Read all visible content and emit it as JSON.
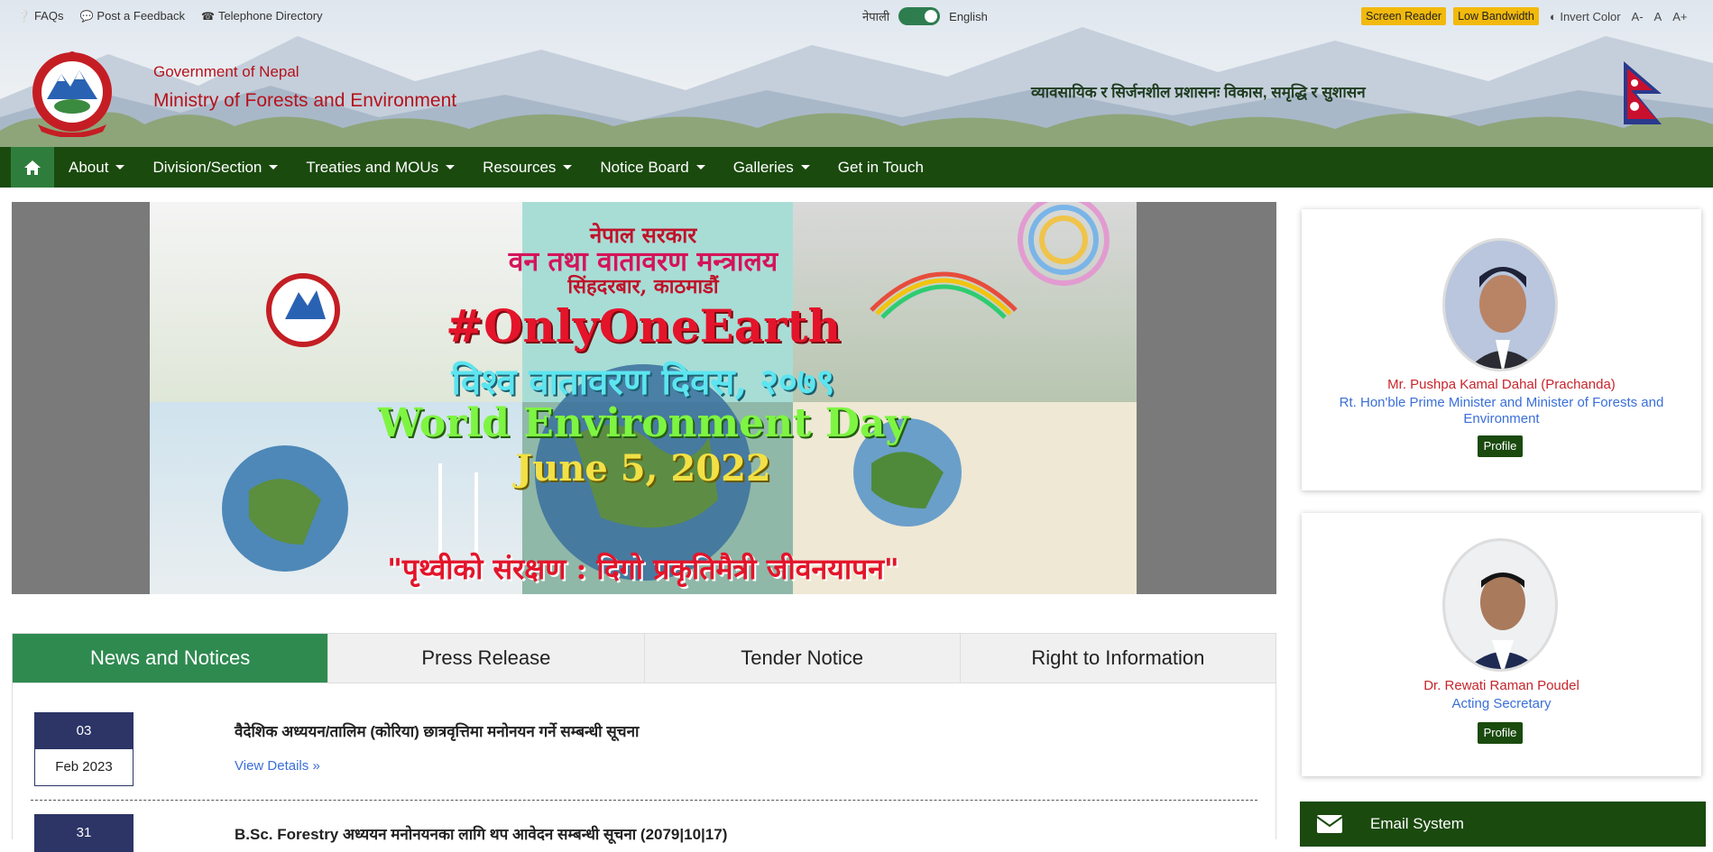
{
  "topbar": {
    "links": [
      {
        "label": "FAQs",
        "icon": "question-circle-icon"
      },
      {
        "label": "Post a Feedback",
        "icon": "comments-icon"
      },
      {
        "label": "Telephone Directory",
        "icon": "phone-icon"
      }
    ],
    "lang_nepali": "नेपाली",
    "lang_english": "English",
    "screen_reader": "Screen Reader",
    "low_bandwidth": "Low Bandwidth",
    "invert_color": "Invert Color",
    "font_small": "A-",
    "font_normal": "A",
    "font_large": "A+"
  },
  "header": {
    "gov_title": "Government of Nepal",
    "ministry_title": "Ministry of Forests and Environment",
    "slogan": "व्यावसायिक र सिर्जनशील प्रशासनः विकास, समृद्धि र सुशासन"
  },
  "nav": {
    "items": [
      {
        "label": "About",
        "dropdown": true
      },
      {
        "label": "Division/Section",
        "dropdown": true
      },
      {
        "label": "Treaties and MOUs",
        "dropdown": true
      },
      {
        "label": "Resources",
        "dropdown": true
      },
      {
        "label": "Notice Board",
        "dropdown": true
      },
      {
        "label": "Galleries",
        "dropdown": true
      },
      {
        "label": "Get in Touch",
        "dropdown": false
      }
    ]
  },
  "banner": {
    "line1": "नेपाल सरकार",
    "line2": "वन तथा वातावरण मन्त्रालय",
    "line3": "सिंहदरबार, काठमाडौं",
    "hashtag": "#OnlyOneEarth",
    "line5": "विश्व वातावरण दिवस, २०७९",
    "line6": "World Environment Day",
    "line7": "June 5, 2022",
    "line8": "\"पृथ्वीको संरक्षण : दिगो प्रकृतिमैत्री जीवनयापन\""
  },
  "tabs": [
    "News and Notices",
    "Press Release",
    "Tender Notice",
    "Right to Information"
  ],
  "news": [
    {
      "day": "03",
      "month": "Feb 2023",
      "title": "वैदेशिक अध्ययन/तालिम (कोरिया) छात्रवृत्तिमा मनोनयन गर्ने सम्बन्धी सूचना",
      "link": "View Details"
    },
    {
      "day": "31",
      "month": "",
      "title": "B.Sc. Forestry अध्ययन मनोनयनका लागि थप आवेदन सम्बन्धी सूचना (2079|10|17)",
      "link": ""
    }
  ],
  "officials": [
    {
      "name": "Mr. Pushpa Kamal Dahal (Prachanda)",
      "role": "Rt. Hon'ble Prime Minister and Minister of Forests and Environment",
      "button": "Profile"
    },
    {
      "name": "Dr. Rewati Raman Poudel",
      "role": "Acting Secretary",
      "button": "Profile"
    }
  ],
  "email_system": "Email System",
  "colors": {
    "nav_green": "#1a4a0e",
    "tab_active": "#2f8a50",
    "accent_red": "#b5121b",
    "highlight_yellow": "#f2b90d",
    "link_blue": "#3a6fd8"
  }
}
